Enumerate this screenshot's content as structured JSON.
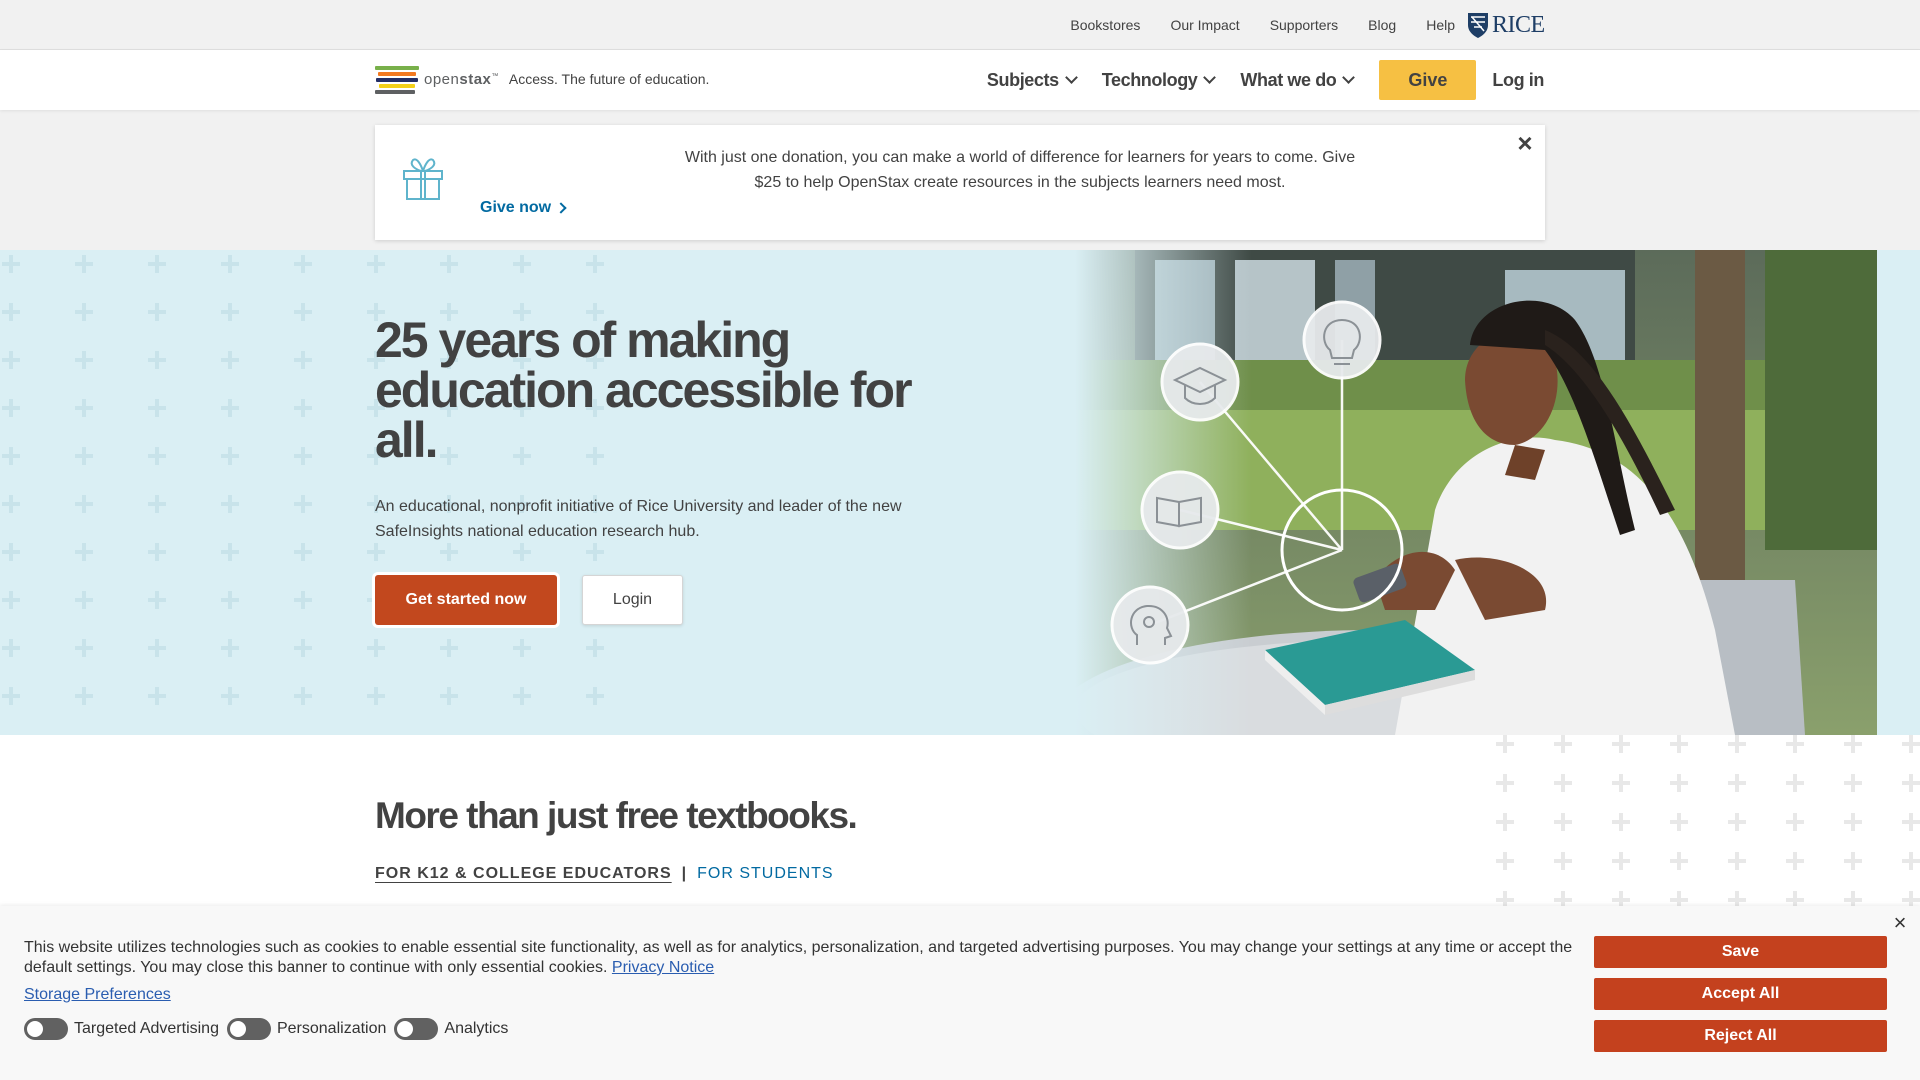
{
  "utility_nav": {
    "links": [
      "Bookstores",
      "Our Impact",
      "Supporters",
      "Blog",
      "Help"
    ],
    "rice_logo": "RICE"
  },
  "header": {
    "brand_name_regular": "open",
    "brand_name_bold": "stax",
    "brand_trademark": "™",
    "tagline": "Access. The future of education.",
    "menu": [
      {
        "label": "Subjects",
        "icon": "chevron-down-icon"
      },
      {
        "label": "Technology",
        "icon": "chevron-down-icon"
      },
      {
        "label": "What we do",
        "icon": "chevron-down-icon"
      }
    ],
    "give_label": "Give",
    "login_label": "Log in"
  },
  "donation_banner": {
    "message": "With just one donation, you can make a world of difference for learners for years to come. Give $25 to help OpenStax create resources in the subjects learners need most.",
    "cta_label": "Give now",
    "icon": "gift-icon",
    "close_icon": "close-icon"
  },
  "hero": {
    "title": "25 years of making education accessible for all.",
    "subtitle": "An educational, nonprofit initiative of Rice University and leader of the new SafeInsights national education research hub.",
    "primary_button": "Get started now",
    "secondary_button": "Login",
    "photo_icons": [
      "graduation-cap-icon",
      "lightbulb-icon",
      "book-icon",
      "head-gear-icon"
    ]
  },
  "section": {
    "title": "More than just free textbooks.",
    "tabs": [
      {
        "label": "FOR K12 & COLLEGE EDUCATORS",
        "active": true
      },
      {
        "label": "FOR STUDENTS",
        "active": false
      }
    ],
    "separator": "|"
  },
  "cookie_banner": {
    "text": "This website utilizes technologies such as cookies to enable essential site functionality, as well as for analytics, personalization, and targeted advertising purposes. You may change your settings at any time or accept the default settings. You may close this banner to continue with only essential cookies.",
    "privacy_link": "Privacy Notice",
    "storage_link": "Storage Preferences",
    "toggles": [
      {
        "label": "Targeted Advertising",
        "on": false
      },
      {
        "label": "Personalization",
        "on": false
      },
      {
        "label": "Analytics",
        "on": false
      }
    ],
    "buttons": {
      "save": "Save",
      "accept_all": "Accept All",
      "reject_all": "Reject All"
    }
  },
  "colors": {
    "accent_orange": "#c2481e",
    "give_yellow": "#f6c043",
    "link_blue": "#026aa1",
    "hero_bg": "#daeff4"
  }
}
